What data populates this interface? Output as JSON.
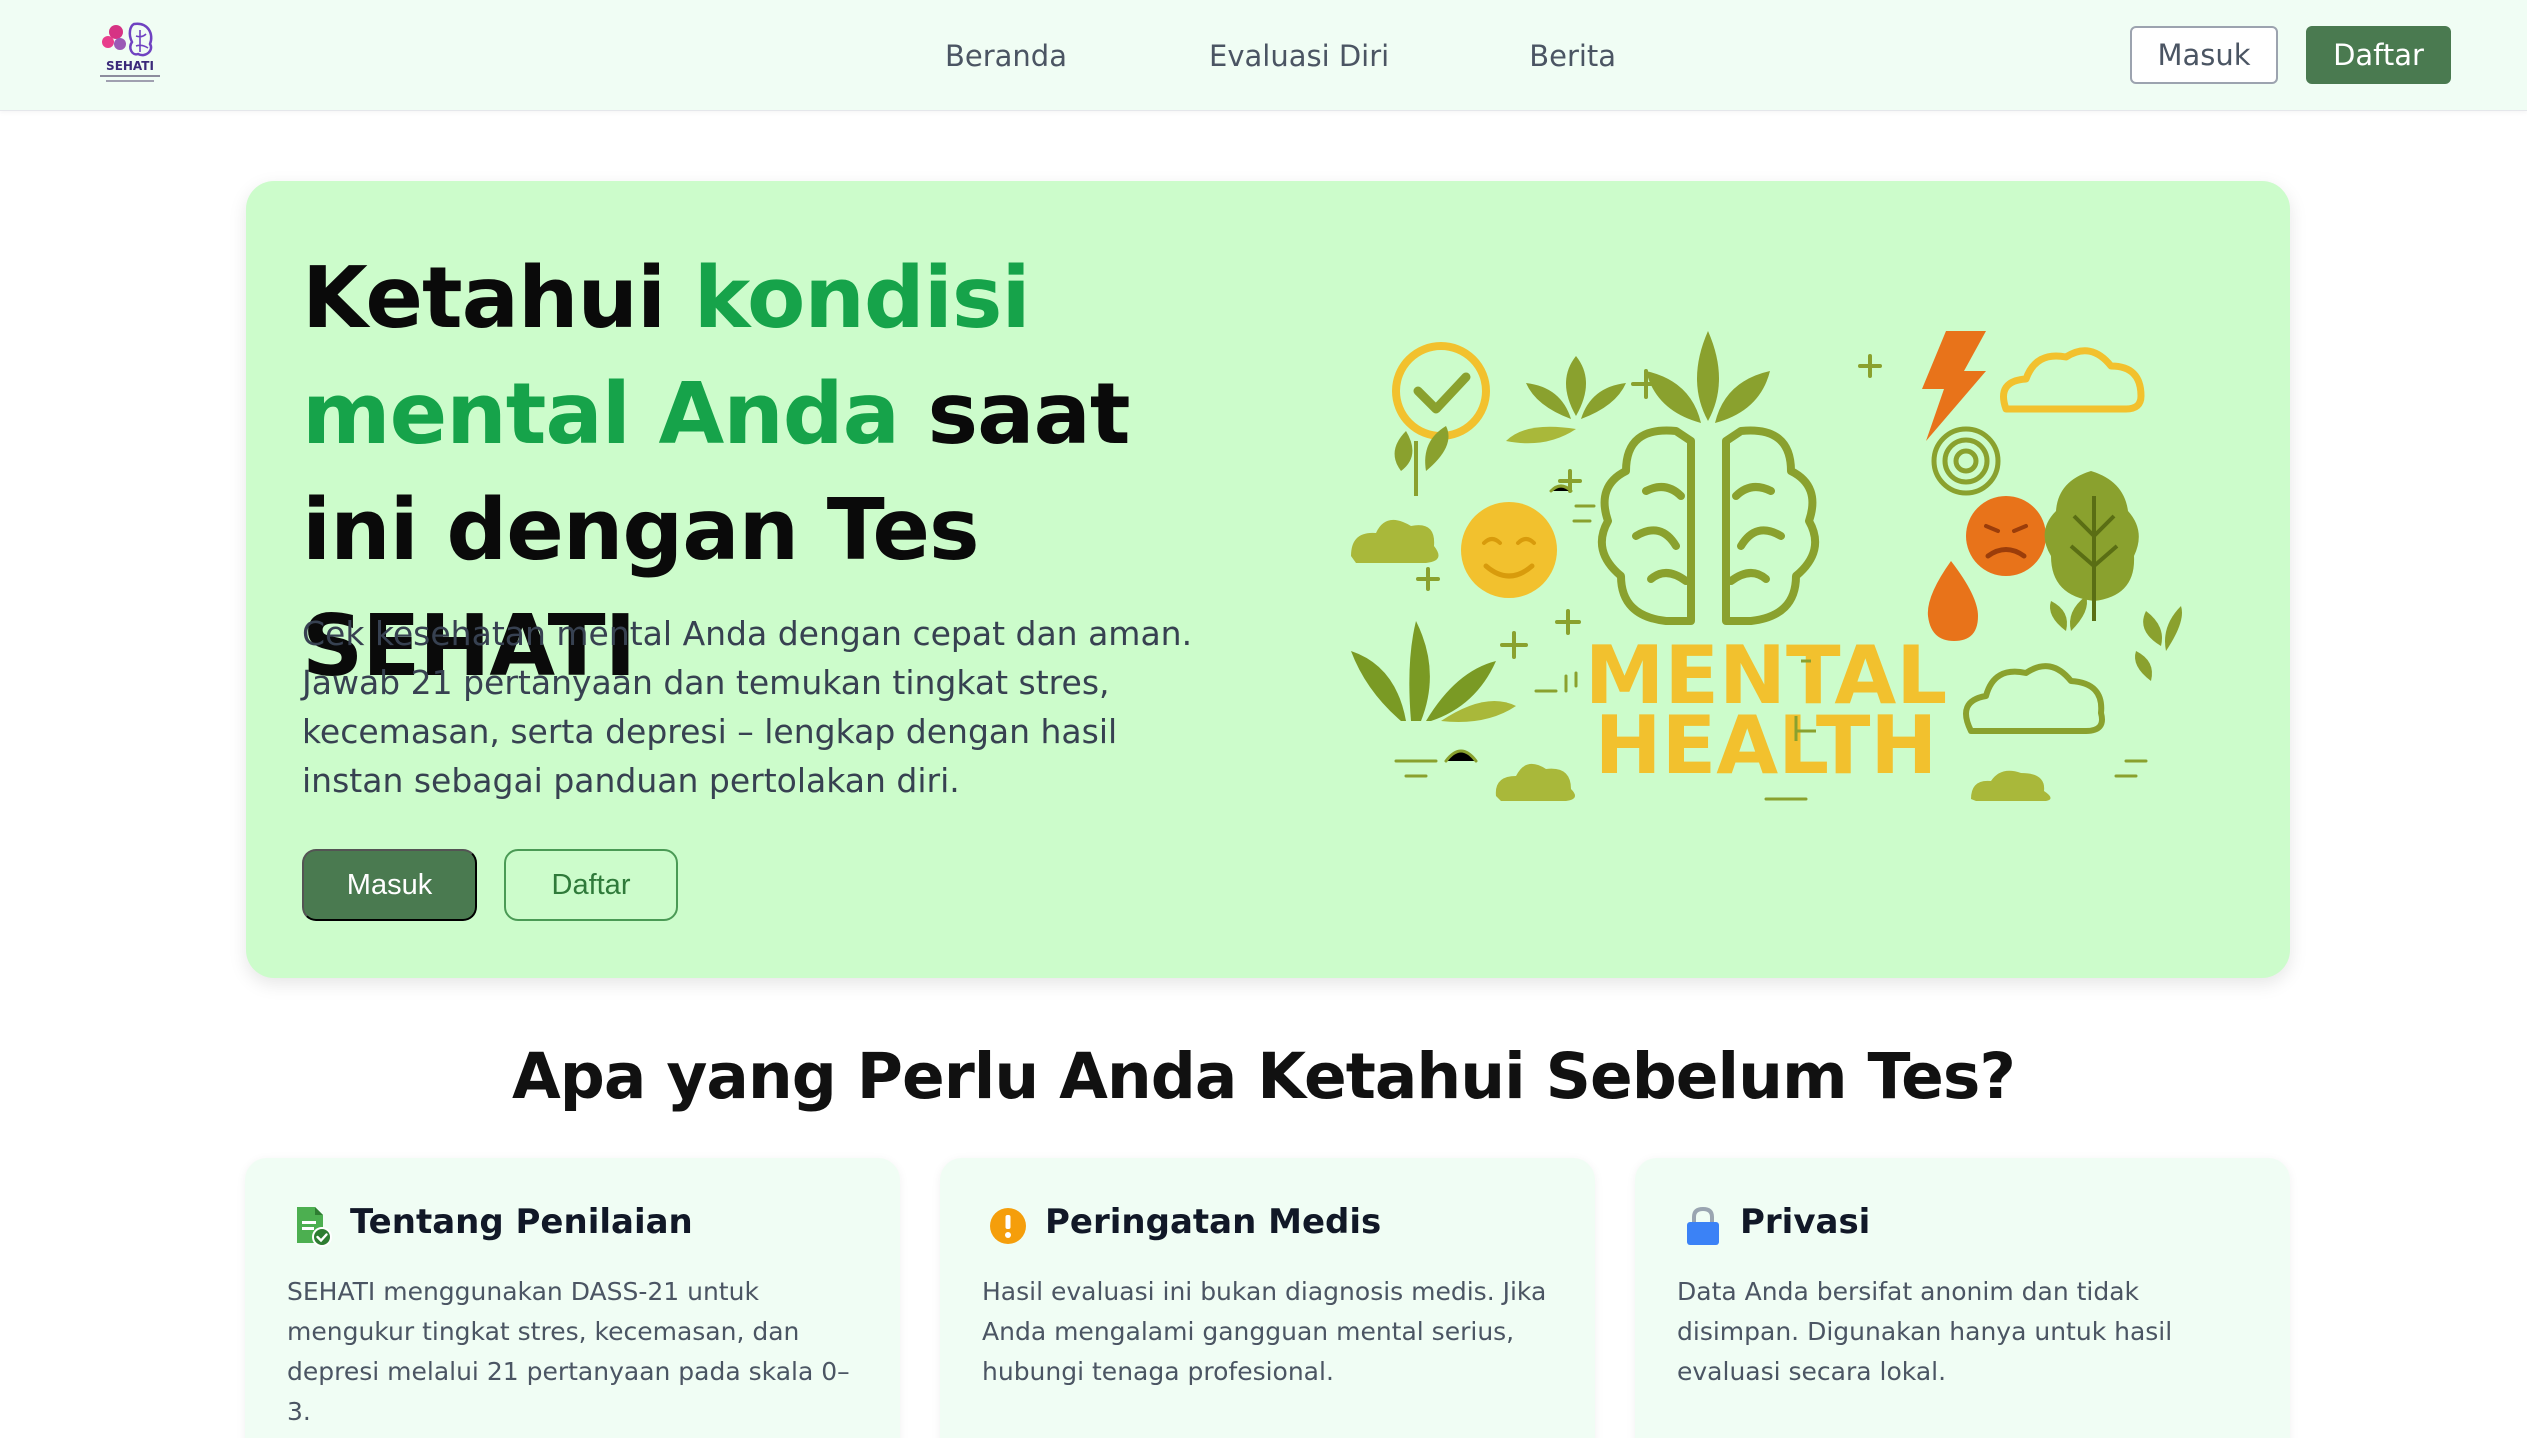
{
  "brand": {
    "name": "SEHATI"
  },
  "nav": {
    "links": [
      "Beranda",
      "Evaluasi Diri",
      "Berita"
    ],
    "login_label": "Masuk",
    "register_label": "Daftar"
  },
  "hero": {
    "title_part1": "Ketahui ",
    "title_highlight": "kondisi mental Anda",
    "title_part2": " saat ini dengan Tes SEHATI",
    "description": "Cek kesehatan mental Anda dengan cepat dan aman. Jawab 21 pertanyaan dan temukan tingkat stres, kecemasan, serta depresi – lengkap dengan hasil instan sebagai panduan pertolakan diri.",
    "login_label": "Masuk",
    "register_label": "Daftar",
    "illustration": {
      "line1": "MENTAL",
      "line2": "HEALTH"
    }
  },
  "info_section": {
    "title": "Apa yang Perlu Anda Ketahui Sebelum Tes?",
    "cards": [
      {
        "icon": "document-check-icon",
        "title": "Tentang Penilaian",
        "body": "SEHATI menggunakan DASS-21 untuk mengukur tingkat stres, kecemasan, dan depresi melalui 21 pertanyaan pada skala 0–3."
      },
      {
        "icon": "warning-icon",
        "title": "Peringatan Medis",
        "body": "Hasil evaluasi ini bukan diagnosis medis. Jika Anda mengalami gangguan mental serius, hubungi tenaga profesional."
      },
      {
        "icon": "lock-icon",
        "title": "Privasi",
        "body": "Data Anda bersifat anonim dan tidak disimpan. Digunakan hanya untuk hasil evaluasi secara lokal."
      }
    ]
  },
  "colors": {
    "primary": "#4a7a50",
    "accent_green": "#16a34a",
    "hero_bg": "#ccfccb",
    "nav_bg": "#f0fdf4"
  }
}
